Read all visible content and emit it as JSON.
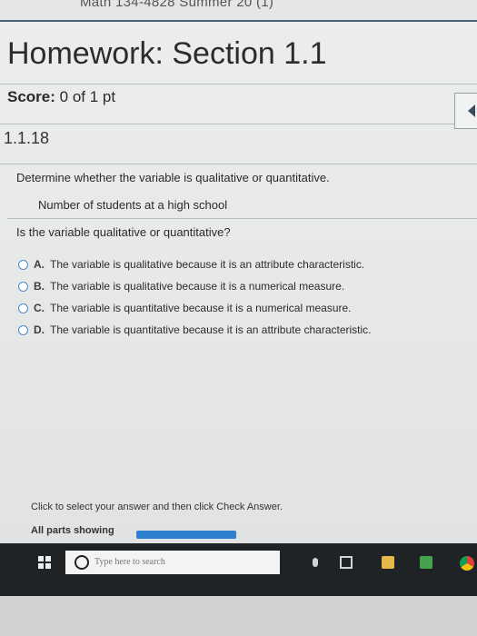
{
  "course": {
    "title": "Math 134-4828 Summer 20 (1)"
  },
  "homework": {
    "title": "Homework: Section 1.1"
  },
  "score": {
    "label": "Score:",
    "value": "0 of 1 pt"
  },
  "question": {
    "number": "1.1.18",
    "prompt": "Determine whether the variable is qualitative or quantitative.",
    "variable": "Number of students at a high school",
    "ask": "Is the variable qualitative or quantitative?",
    "options": [
      {
        "letter": "A.",
        "text": "The variable is qualitative because it is an attribute characteristic."
      },
      {
        "letter": "B.",
        "text": "The variable is qualitative because it is a numerical measure."
      },
      {
        "letter": "C.",
        "text": "The variable is quantitative because it is a numerical measure."
      },
      {
        "letter": "D.",
        "text": "The variable is quantitative because it is an attribute characteristic."
      }
    ]
  },
  "footer": {
    "instruction": "Click to select your answer and then click Check Answer.",
    "parts_label": "All parts showing"
  },
  "taskbar": {
    "search_placeholder": "Type here to search",
    "icons": [
      "windows-start-icon",
      "search-icon",
      "microphone-icon",
      "task-view-icon",
      "file-explorer-icon",
      "store-icon",
      "chrome-icon"
    ]
  },
  "colors": {
    "accent": "#2f7fcf",
    "radio": "#4d88c7",
    "taskbar": "#1f2326"
  }
}
